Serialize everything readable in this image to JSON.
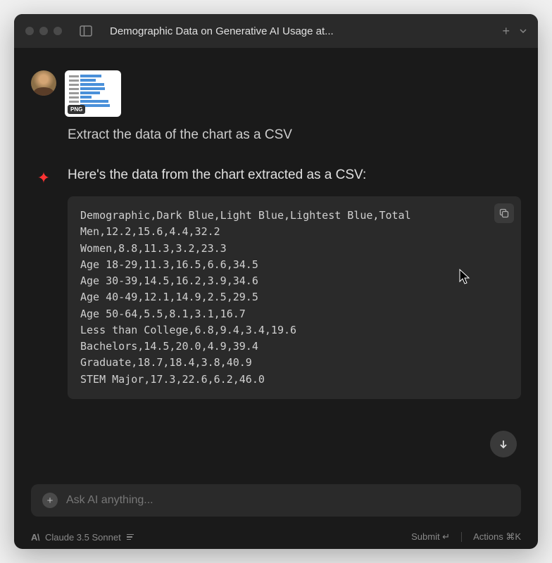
{
  "titlebar": {
    "title": "Demographic Data on Generative AI Usage at..."
  },
  "user_message": {
    "attachment_badge": "PNG",
    "text": "Extract the data of the chart as a CSV"
  },
  "ai_message": {
    "text": "Here's the data from the chart extracted as a CSV:",
    "code": "Demographic,Dark Blue,Light Blue,Lightest Blue,Total\nMen,12.2,15.6,4.4,32.2\nWomen,8.8,11.3,3.2,23.3\nAge 18-29,11.3,16.5,6.6,34.5\nAge 30-39,14.5,16.2,3.9,34.6\nAge 40-49,12.1,14.9,2.5,29.5\nAge 50-64,5.5,8.1,3.1,16.7\nLess than College,6.8,9.4,3.4,19.6\nBachelors,14.5,20.0,4.9,39.4\nGraduate,18.7,18.4,3.8,40.9\nSTEM Major,17.3,22.6,6.2,46.0"
  },
  "composer": {
    "placeholder": "Ask AI anything..."
  },
  "statusbar": {
    "model": "Claude 3.5 Sonnet",
    "submit": "Submit ↵",
    "actions": "Actions ⌘K"
  }
}
